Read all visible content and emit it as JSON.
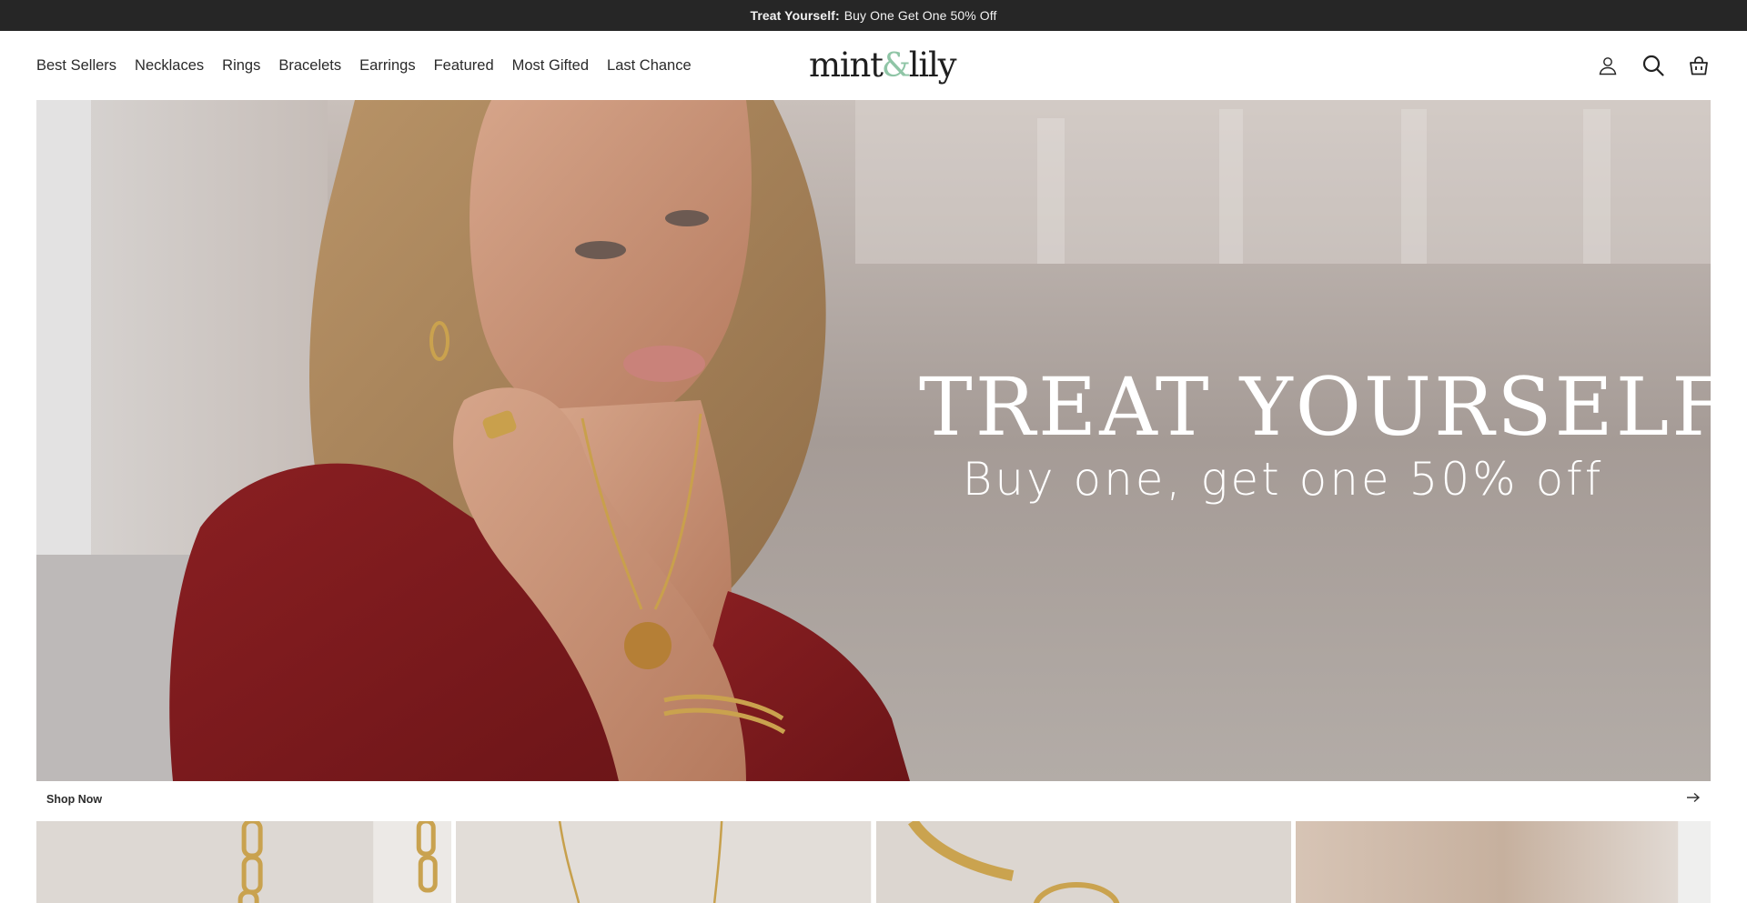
{
  "announcement": {
    "bold": "Treat Yourself:",
    "text": "Buy One Get One 50% Off"
  },
  "header": {
    "nav": [
      "Best Sellers",
      "Necklaces",
      "Rings",
      "Bracelets",
      "Earrings",
      "Featured",
      "Most Gifted",
      "Last Chance"
    ],
    "logo": {
      "left": "mint",
      "amp": "&",
      "right": "lily"
    },
    "icons": [
      "account-icon",
      "search-icon",
      "cart-icon"
    ]
  },
  "hero": {
    "title": "TREAT YOURSELF",
    "subtitle": "Buy one, get one 50% off",
    "image": "model-with-gold-jewelry-photo"
  },
  "shop_now": {
    "label": "Shop Now",
    "icon": "arrow-right-icon"
  },
  "tiles": [
    "paperclip-chain-photo",
    "pendant-necklace-photo",
    "herringbone-chain-photo",
    "jewelry-photo"
  ],
  "colors": {
    "announcement_bg": "#262626",
    "logo_accent": "#8fc5a6",
    "hero_text": "#ffffff"
  }
}
